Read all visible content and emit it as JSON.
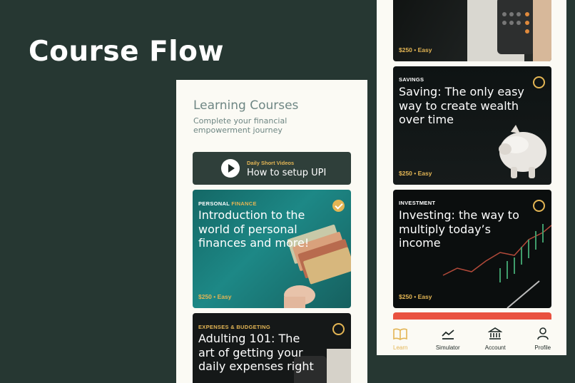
{
  "hero": {
    "title": "Course Flow"
  },
  "screen1": {
    "title": "Learning Courses",
    "subtitle": "Complete your financial empowerment journey",
    "video": {
      "label": "Daily Short Videos",
      "title": "How to setup UPI"
    },
    "courses": [
      {
        "category_a": "PERSONAL ",
        "category_b": "FINANCE",
        "title": "Introduction to the world of personal finances and more!",
        "meta": "$250 • Easy",
        "completed": true
      },
      {
        "category_a": "EXPENSES & BUDGETING",
        "category_b": "",
        "title": "Adulting 101: The art of getting your daily expenses right",
        "meta": "",
        "completed": false
      }
    ]
  },
  "screen2": {
    "courses": [
      {
        "category": "",
        "title": "",
        "meta": "$250 • Easy",
        "completed": false
      },
      {
        "category": "SAVINGS",
        "title": "Saving: The only easy way to create wealth over time",
        "meta": "$250 • Easy",
        "completed": false
      },
      {
        "category": "INVESTMENT",
        "title": "Investing: the way to multiply today’s income",
        "meta": "$250 • Easy",
        "completed": false
      }
    ],
    "tabs": [
      {
        "label": "Learn",
        "icon": "book-icon",
        "active": true
      },
      {
        "label": "Simulator",
        "icon": "chart-icon",
        "active": false
      },
      {
        "label": "Account",
        "icon": "bank-icon",
        "active": false
      },
      {
        "label": "Profile",
        "icon": "user-icon",
        "active": false
      }
    ]
  },
  "colors": {
    "background": "#263732",
    "accent": "#e3b554",
    "card_dark": "#2f3f3a",
    "alert": "#e9513f"
  }
}
